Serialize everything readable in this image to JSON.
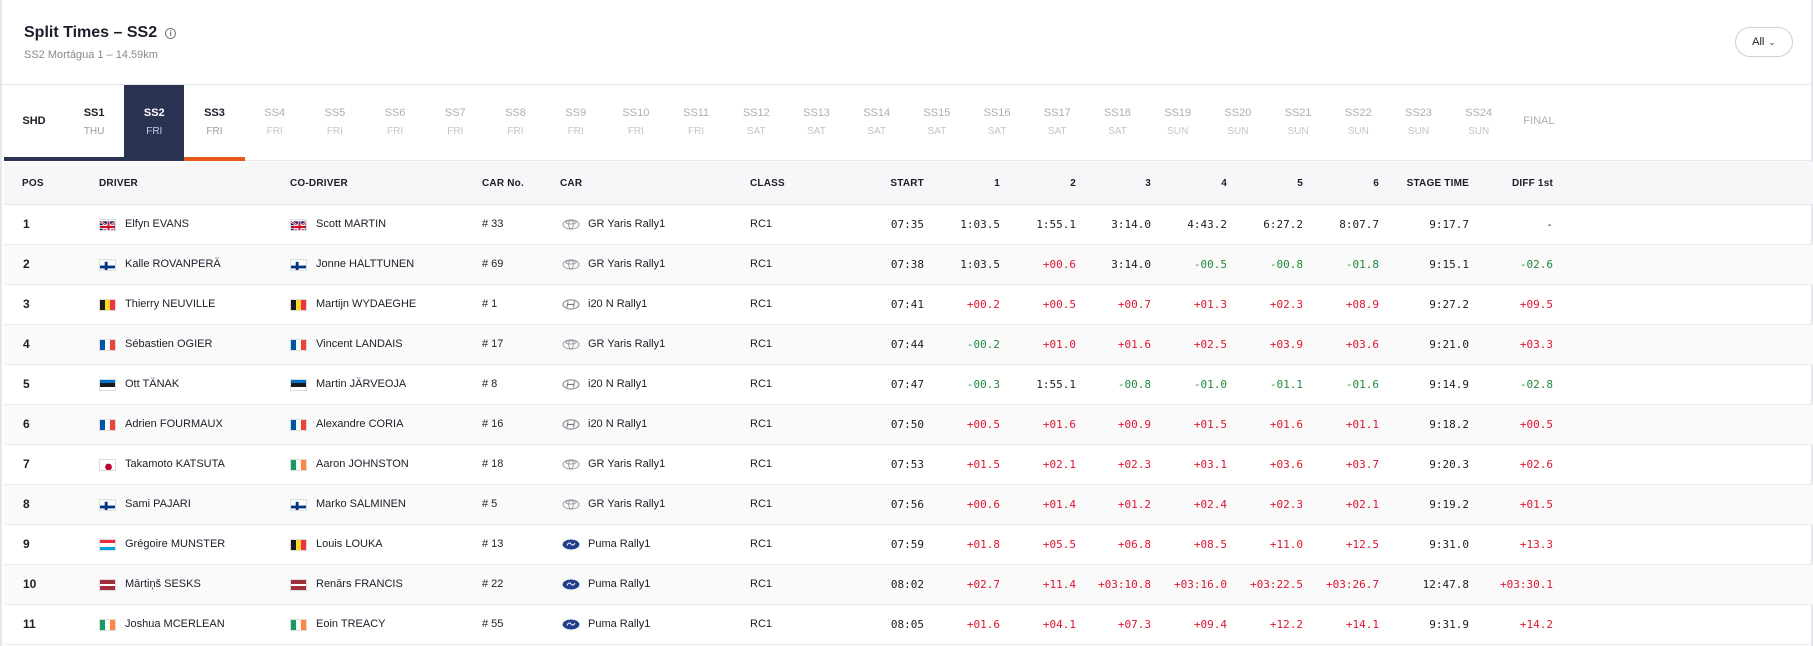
{
  "header": {
    "title": "Split Times – SS2",
    "info_icon": "i",
    "subtitle": "SS2 Mortágua 1 – 14.59km",
    "filter_label": "All",
    "filter_chevron": "⌄"
  },
  "tabs": [
    {
      "name": "SHD",
      "day": "",
      "state": "shd"
    },
    {
      "name": "SS1",
      "day": "THU",
      "state": "done"
    },
    {
      "name": "SS2",
      "day": "FRI",
      "state": "active"
    },
    {
      "name": "SS3",
      "day": "FRI",
      "state": "done"
    },
    {
      "name": "SS4",
      "day": "FRI",
      "state": "future"
    },
    {
      "name": "SS5",
      "day": "FRI",
      "state": "future"
    },
    {
      "name": "SS6",
      "day": "FRI",
      "state": "future"
    },
    {
      "name": "SS7",
      "day": "FRI",
      "state": "future"
    },
    {
      "name": "SS8",
      "day": "FRI",
      "state": "future"
    },
    {
      "name": "SS9",
      "day": "FRI",
      "state": "future"
    },
    {
      "name": "SS10",
      "day": "FRI",
      "state": "future"
    },
    {
      "name": "SS11",
      "day": "FRI",
      "state": "future"
    },
    {
      "name": "SS12",
      "day": "SAT",
      "state": "future"
    },
    {
      "name": "SS13",
      "day": "SAT",
      "state": "future"
    },
    {
      "name": "SS14",
      "day": "SAT",
      "state": "future"
    },
    {
      "name": "SS15",
      "day": "SAT",
      "state": "future"
    },
    {
      "name": "SS16",
      "day": "SAT",
      "state": "future"
    },
    {
      "name": "SS17",
      "day": "SAT",
      "state": "future"
    },
    {
      "name": "SS18",
      "day": "SAT",
      "state": "future"
    },
    {
      "name": "SS19",
      "day": "SUN",
      "state": "future"
    },
    {
      "name": "SS20",
      "day": "SUN",
      "state": "future"
    },
    {
      "name": "SS21",
      "day": "SUN",
      "state": "future"
    },
    {
      "name": "SS22",
      "day": "SUN",
      "state": "future"
    },
    {
      "name": "SS23",
      "day": "SUN",
      "state": "future"
    },
    {
      "name": "SS24",
      "day": "SUN",
      "state": "future"
    },
    {
      "name": "FINAL",
      "day": "",
      "state": "final"
    }
  ],
  "colors": {
    "active_tab_bg": "#2a3352",
    "completed_bar": "#2a3352",
    "next_bar": "#e8581c",
    "faster": "#1f8a3a",
    "slower": "#e0142f"
  },
  "table": {
    "headers": {
      "pos": "POS",
      "driver": "DRIVER",
      "codriver": "CO-DRIVER",
      "carno": "CAR No.",
      "car": "CAR",
      "class": "CLASS",
      "start": "START",
      "s1": "1",
      "s2": "2",
      "s3": "3",
      "s4": "4",
      "s5": "5",
      "s6": "6",
      "stage_time": "STAGE TIME",
      "diff": "DIFF 1st"
    },
    "rows": [
      {
        "pos": "1",
        "driver_flag": "gb",
        "driver": "Elfyn EVANS",
        "codriver_flag": "gb",
        "codriver": "Scott MARTIN",
        "carno": "# 33",
        "brand": "toyota",
        "car": "GR Yaris Rally1",
        "class": "RC1",
        "start": "07:35",
        "splits": [
          "1:03.5",
          "1:55.1",
          "3:14.0",
          "4:43.2",
          "6:27.2",
          "8:07.7"
        ],
        "stage_time": "9:17.7",
        "diff": "-"
      },
      {
        "pos": "2",
        "driver_flag": "fi",
        "driver": "Kalle ROVANPERÄ",
        "codriver_flag": "fi",
        "codriver": "Jonne HALTTUNEN",
        "carno": "# 69",
        "brand": "toyota",
        "car": "GR Yaris Rally1",
        "class": "RC1",
        "start": "07:38",
        "splits": [
          "1:03.5",
          "+00.6",
          "3:14.0",
          "-00.5",
          "-00.8",
          "-01.8"
        ],
        "stage_time": "9:15.1",
        "diff": "-02.6"
      },
      {
        "pos": "3",
        "driver_flag": "be",
        "driver": "Thierry NEUVILLE",
        "codriver_flag": "be",
        "codriver": "Martijn WYDAEGHE",
        "carno": "# 1",
        "brand": "hyundai",
        "car": "i20 N Rally1",
        "class": "RC1",
        "start": "07:41",
        "splits": [
          "+00.2",
          "+00.5",
          "+00.7",
          "+01.3",
          "+02.3",
          "+08.9"
        ],
        "stage_time": "9:27.2",
        "diff": "+09.5"
      },
      {
        "pos": "4",
        "driver_flag": "fr",
        "driver": "Sébastien OGIER",
        "codriver_flag": "fr",
        "codriver": "Vincent LANDAIS",
        "carno": "# 17",
        "brand": "toyota",
        "car": "GR Yaris Rally1",
        "class": "RC1",
        "start": "07:44",
        "splits": [
          "-00.2",
          "+01.0",
          "+01.6",
          "+02.5",
          "+03.9",
          "+03.6"
        ],
        "stage_time": "9:21.0",
        "diff": "+03.3"
      },
      {
        "pos": "5",
        "driver_flag": "ee",
        "driver": "Ott TÄNAK",
        "codriver_flag": "ee",
        "codriver": "Martin JÄRVEOJA",
        "carno": "# 8",
        "brand": "hyundai",
        "car": "i20 N Rally1",
        "class": "RC1",
        "start": "07:47",
        "splits": [
          "-00.3",
          "1:55.1",
          "-00.8",
          "-01.0",
          "-01.1",
          "-01.6"
        ],
        "stage_time": "9:14.9",
        "diff": "-02.8"
      },
      {
        "pos": "6",
        "driver_flag": "fr",
        "driver": "Adrien FOURMAUX",
        "codriver_flag": "fr",
        "codriver": "Alexandre CORIA",
        "carno": "# 16",
        "brand": "hyundai",
        "car": "i20 N Rally1",
        "class": "RC1",
        "start": "07:50",
        "splits": [
          "+00.5",
          "+01.6",
          "+00.9",
          "+01.5",
          "+01.6",
          "+01.1"
        ],
        "stage_time": "9:18.2",
        "diff": "+00.5"
      },
      {
        "pos": "7",
        "driver_flag": "jp",
        "driver": "Takamoto KATSUTA",
        "codriver_flag": "ie",
        "codriver": "Aaron JOHNSTON",
        "carno": "# 18",
        "brand": "toyota",
        "car": "GR Yaris Rally1",
        "class": "RC1",
        "start": "07:53",
        "splits": [
          "+01.5",
          "+02.1",
          "+02.3",
          "+03.1",
          "+03.6",
          "+03.7"
        ],
        "stage_time": "9:20.3",
        "diff": "+02.6"
      },
      {
        "pos": "8",
        "driver_flag": "fi",
        "driver": "Sami PAJARI",
        "codriver_flag": "fi",
        "codriver": "Marko SALMINEN",
        "carno": "# 5",
        "brand": "toyota",
        "car": "GR Yaris Rally1",
        "class": "RC1",
        "start": "07:56",
        "splits": [
          "+00.6",
          "+01.4",
          "+01.2",
          "+02.4",
          "+02.3",
          "+02.1"
        ],
        "stage_time": "9:19.2",
        "diff": "+01.5"
      },
      {
        "pos": "9",
        "driver_flag": "lu",
        "driver": "Grégoire MUNSTER",
        "codriver_flag": "be",
        "codriver": "Louis LOUKA",
        "carno": "# 13",
        "brand": "ford",
        "car": "Puma Rally1",
        "class": "RC1",
        "start": "07:59",
        "splits": [
          "+01.8",
          "+05.5",
          "+06.8",
          "+08.5",
          "+11.0",
          "+12.5"
        ],
        "stage_time": "9:31.0",
        "diff": "+13.3"
      },
      {
        "pos": "10",
        "driver_flag": "lv",
        "driver": "Mārtiņš SESKS",
        "codriver_flag": "lv",
        "codriver": "Renārs FRANCIS",
        "carno": "# 22",
        "brand": "ford",
        "car": "Puma Rally1",
        "class": "RC1",
        "start": "08:02",
        "splits": [
          "+02.7",
          "+11.4",
          "+03:10.8",
          "+03:16.0",
          "+03:22.5",
          "+03:26.7"
        ],
        "stage_time": "12:47.8",
        "diff": "+03:30.1"
      },
      {
        "pos": "11",
        "driver_flag": "ie",
        "driver": "Joshua MCERLEAN",
        "codriver_flag": "ie",
        "codriver": "Eoin TREACY",
        "carno": "# 55",
        "brand": "ford",
        "car": "Puma Rally1",
        "class": "RC1",
        "start": "08:05",
        "splits": [
          "+01.6",
          "+04.1",
          "+07.3",
          "+09.4",
          "+12.2",
          "+14.1"
        ],
        "stage_time": "9:31.9",
        "diff": "+14.2"
      }
    ]
  }
}
